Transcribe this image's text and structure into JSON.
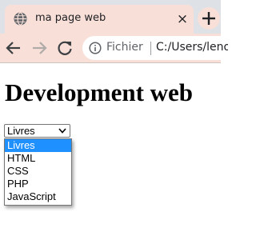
{
  "browser": {
    "tab": {
      "title": "ma page web",
      "close_glyph": "×",
      "favicon": "globe-icon"
    },
    "new_tab_glyph": "+",
    "address_bar": {
      "site_chip": "Fichier",
      "url": "C:/Users/lenovo"
    },
    "nav_icons": [
      "back-arrow-icon",
      "forward-arrow-icon",
      "reload-icon",
      "info-icon"
    ]
  },
  "page": {
    "heading": "Development web",
    "select": {
      "value": "Livres",
      "options": [
        "Livres",
        "HTML",
        "CSS",
        "PHP",
        "JavaScript"
      ],
      "highlighted_index": 0
    }
  },
  "colors": {
    "active_tab": "#f8e0d9",
    "tabstrip": "#dee1e6",
    "highlight": "#1e90ff"
  }
}
